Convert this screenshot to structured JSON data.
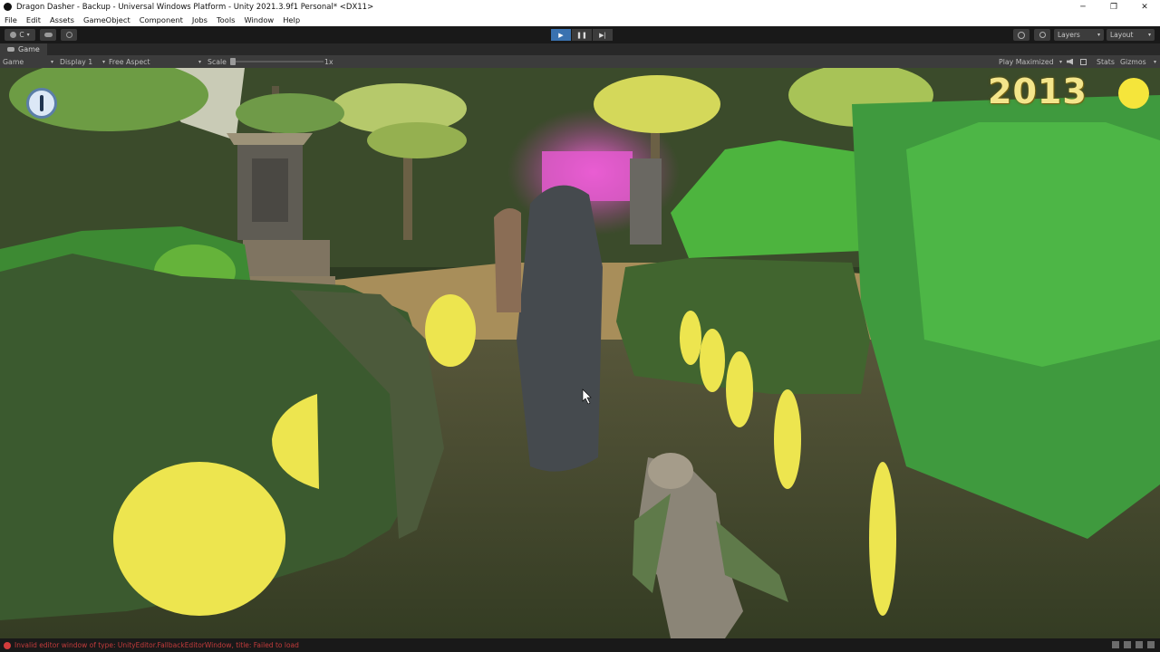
{
  "window": {
    "title": "Dragon Dasher - Backup - Universal Windows Platform - Unity 2021.3.9f1 Personal* <DX11>",
    "minimize": "─",
    "restore": "❐",
    "close": "✕"
  },
  "menu": [
    "File",
    "Edit",
    "Assets",
    "GameObject",
    "Component",
    "Jobs",
    "Tools",
    "Window",
    "Help"
  ],
  "toolbar": {
    "account_label": "C",
    "layers_label": "Layers",
    "layout_label": "Layout",
    "play_icon": "▶",
    "pause_icon": "❚❚",
    "step_icon": "▶|"
  },
  "dock": {
    "tab_label": "Game"
  },
  "gamebar": {
    "mode": "Game",
    "display": "Display 1",
    "aspect": "Free Aspect",
    "scale_label": "Scale",
    "scale_value": "1x",
    "play_maximized": "Play Maximized",
    "stats": "Stats",
    "gizmos": "Gizmos"
  },
  "hud": {
    "score": "2013"
  },
  "status": {
    "error_message": "Invalid editor window of type: UnityEditor.FallbackEditorWindow, title: Failed to load"
  },
  "colors": {
    "accent": "#3a72b0",
    "coin": "#f5e53b",
    "error": "#c23b3b"
  },
  "icons": {
    "play": "play-icon",
    "pause": "pause-icon",
    "step": "step-icon",
    "history": "history-icon",
    "search": "search-icon",
    "cloud": "cloud-icon",
    "collab": "collab-icon",
    "mute": "mute-audio-icon"
  }
}
